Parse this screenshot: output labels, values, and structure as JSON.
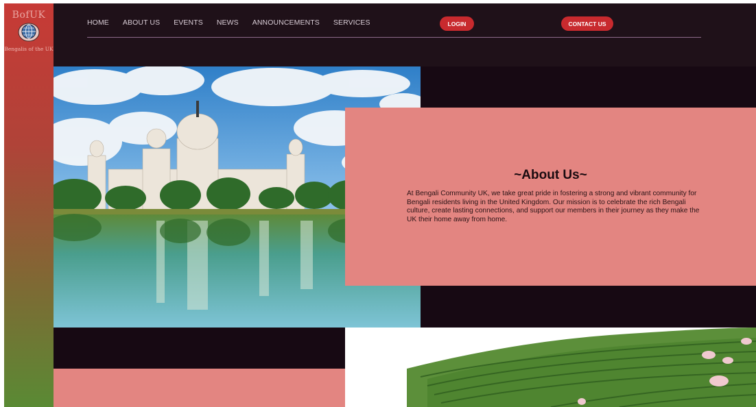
{
  "brand": {
    "logo_text": "BofUK",
    "caption": "Bengalis of the UK"
  },
  "nav": {
    "items": [
      {
        "label": "HOME"
      },
      {
        "label": "ABOUT US"
      },
      {
        "label": "EVENTS"
      },
      {
        "label": "NEWS"
      },
      {
        "label": "ANNOUNCEMENTS"
      },
      {
        "label": "SERVICES"
      }
    ],
    "login_label": "LOGIN",
    "contact_label": "CONTACT US"
  },
  "about": {
    "title": "~About Us~",
    "body": "At Bengali Community UK, we take great pride in fostering a strong and vibrant community for Bengali residents living in the United Kingdom. Our mission is to celebrate the rich Bengali culture, create lasting connections, and support our members in their journey as they make the UK their home away from home."
  },
  "colors": {
    "background": "#170913",
    "header": "#1f1119",
    "accent_button": "#c82a2e",
    "panel_pink": "#e38581",
    "sidebar_top": "#c73a36",
    "sidebar_bottom": "#5a8a34"
  }
}
